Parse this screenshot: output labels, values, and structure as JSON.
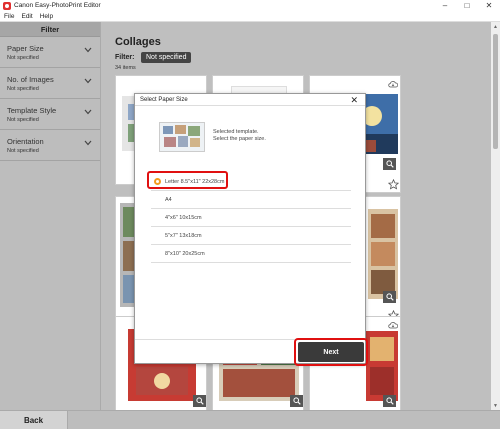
{
  "window": {
    "title": "Canon Easy-PhotoPrint Editor",
    "minimize": "–",
    "maximize": "□",
    "close": "✕"
  },
  "menu": {
    "file": "File",
    "edit": "Edit",
    "help": "Help"
  },
  "sidebar": {
    "header": "Filter",
    "items": [
      {
        "name": "Paper Size",
        "value": "Not specified"
      },
      {
        "name": "No. of Images",
        "value": "Not specified"
      },
      {
        "name": "Template Style",
        "value": "Not specified"
      },
      {
        "name": "Orientation",
        "value": "Not specified"
      }
    ]
  },
  "main": {
    "title": "Collages",
    "filter_label": "Filter:",
    "filter_value": "Not specified",
    "item_count": "34 items"
  },
  "dialog": {
    "title": "Select Paper Size",
    "close": "✕",
    "selected_template_text": "Selected template.",
    "instruction": "Select the paper size.",
    "sizes": [
      "Letter 8.5\"x11\" 22x28cm",
      "A4",
      "4\"x6\" 10x15cm",
      "5\"x7\" 13x18cm",
      "8\"x10\" 20x25cm"
    ],
    "selected_size": "Letter 8.5\"x11\" 22x28cm",
    "next_label": "Next"
  },
  "footer": {
    "back_label": "Back"
  },
  "colors": {
    "accent": "#f39c1e",
    "highlight": "#e01010",
    "primary_button": "#3a3a3a"
  }
}
